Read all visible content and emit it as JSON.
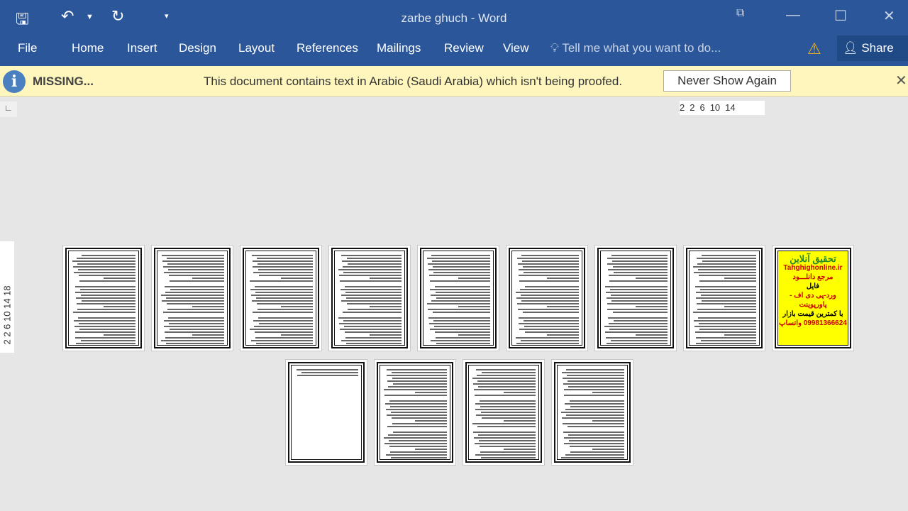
{
  "title_bar": {
    "document_title": "zarbe ghuch - Word"
  },
  "quick_access": {
    "icons": [
      "save-icon",
      "undo-icon",
      "undo-dropdown-icon",
      "redo-icon",
      "customize-icon"
    ]
  },
  "ribbon": {
    "tabs": [
      {
        "label": "File"
      },
      {
        "label": "Home"
      },
      {
        "label": "Insert"
      },
      {
        "label": "Design"
      },
      {
        "label": "Layout"
      },
      {
        "label": "References"
      },
      {
        "label": "Mailings"
      },
      {
        "label": "Review"
      },
      {
        "label": "View"
      }
    ],
    "tell_me_placeholder": "Tell me what you want to do...",
    "share_label": "Share"
  },
  "message_bar": {
    "title": "MISSING...",
    "text": "This document contains text in Arabic (Saudi Arabia) which isn't being proofed.",
    "button_label": "Never Show Again"
  },
  "rulers": {
    "horizontal": [
      "2",
      "2",
      "6",
      "10",
      "14"
    ],
    "vertical": "2  2  6  10  14  18"
  },
  "ad_page": {
    "lines": [
      "تحقیق آنلاین",
      "Tahghighonline.ir",
      "مرجع دانلـــود",
      "فایل",
      "ورد-پی دی اف - پاورپوینت",
      "با کمترین قیمت بازار",
      "09981366624 واتساپ"
    ]
  },
  "pages": {
    "count": 13
  }
}
